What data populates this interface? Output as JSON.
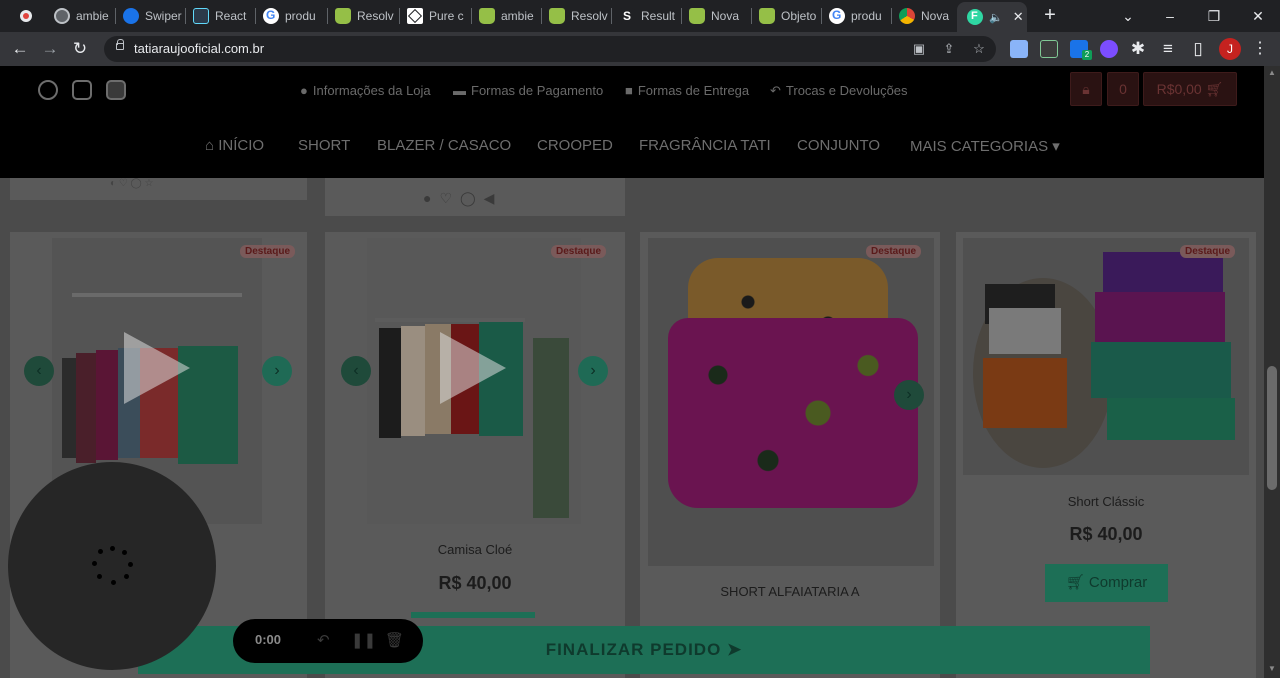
{
  "browser": {
    "tabs": [
      {
        "title": "ambie",
        "icon": "globe-icon"
      },
      {
        "title": "Swiper",
        "icon": "swiper-icon"
      },
      {
        "title": "React",
        "icon": "react-icon"
      },
      {
        "title": "produ",
        "icon": "google-icon"
      },
      {
        "title": "Resolv",
        "icon": "shopify-icon"
      },
      {
        "title": "Pure c",
        "icon": "codesandbox-icon"
      },
      {
        "title": "ambie",
        "icon": "shopify-icon"
      },
      {
        "title": "Resolv",
        "icon": "shopify-icon"
      },
      {
        "title": "Result",
        "icon": "s-icon"
      },
      {
        "title": "Nova",
        "icon": "shopify-icon"
      },
      {
        "title": "Objeto",
        "icon": "shopify-icon"
      },
      {
        "title": "produ",
        "icon": "google-icon"
      },
      {
        "title": "Nova",
        "icon": "chrome-icon"
      }
    ],
    "active_tab": {
      "icon": "f-icon",
      "audio": "speaker-icon",
      "close": "✕"
    },
    "new_tab": "+",
    "url": "tatiaraujooficial.com.br",
    "profile_initial": "J",
    "extension_badge": "2"
  },
  "site": {
    "info_links": [
      {
        "icon": "info-icon",
        "label": "Informações da Loja"
      },
      {
        "icon": "credit-card-icon",
        "label": "Formas de Pagamento"
      },
      {
        "icon": "truck-icon",
        "label": "Formas de Entrega"
      },
      {
        "icon": "undo-icon",
        "label": "Trocas e Devoluções"
      }
    ],
    "cart": {
      "count": "0",
      "total": "R$0,00"
    },
    "nav": [
      {
        "label": "INÍCIO",
        "icon": "home-icon"
      },
      {
        "label": "SHORT"
      },
      {
        "label": "BLAZER / CASACO"
      },
      {
        "label": "CROOPED"
      },
      {
        "label": "FRAGRÂNCIA TATI"
      },
      {
        "label": "CONJUNTO"
      },
      {
        "label": "MAIS CATEGORIAS",
        "icon": "caret-down-icon"
      }
    ]
  },
  "products": [
    {
      "badge": "Destaque",
      "name": "",
      "price": "",
      "buy_label": ""
    },
    {
      "badge": "Destaque",
      "name": "Camisa Cloé",
      "price": "R$ 40,00",
      "buy_label": ""
    },
    {
      "badge": "Destaque",
      "name": "SHORT ALFAIATARIA A",
      "price": "",
      "buy_label": ""
    },
    {
      "badge": "Destaque",
      "name": "Short Clássic",
      "price": "R$ 40,00",
      "buy_label": "Comprar"
    }
  ],
  "checkout": {
    "label": "FINALIZAR PEDIDO"
  },
  "recorder": {
    "time": "0:00"
  },
  "colors": {
    "accent": "#1d6f56",
    "badge": "#7a5a5a",
    "header_bg": "#000000"
  }
}
